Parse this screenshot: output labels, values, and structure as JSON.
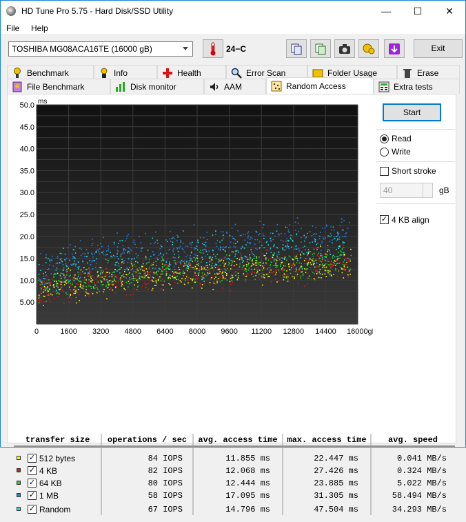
{
  "window": {
    "title": "HD Tune Pro 5.75 - Hard Disk/SSD Utility",
    "minimize": "—",
    "maximize": "☐",
    "close": "✕"
  },
  "menu": {
    "file": "File",
    "help": "Help"
  },
  "toolbar": {
    "drive": "TOSHIBA MG08ACA16TE (16000 gB)",
    "temperature": "24−C",
    "exit": "Exit"
  },
  "tabs": {
    "row1": [
      {
        "label": "Benchmark",
        "icon": "benchmark-icon"
      },
      {
        "label": "Info",
        "icon": "info-icon"
      },
      {
        "label": "Health",
        "icon": "health-icon"
      },
      {
        "label": "Error Scan",
        "icon": "error-scan-icon"
      },
      {
        "label": "Folder Usage",
        "icon": "folder-usage-icon"
      },
      {
        "label": "Erase",
        "icon": "erase-icon"
      }
    ],
    "row2": [
      {
        "label": "File Benchmark",
        "icon": "file-benchmark-icon"
      },
      {
        "label": "Disk monitor",
        "icon": "disk-monitor-icon"
      },
      {
        "label": "AAM",
        "icon": "aam-icon"
      },
      {
        "label": "Random Access",
        "icon": "random-access-icon",
        "active": true
      },
      {
        "label": "Extra tests",
        "icon": "extra-tests-icon"
      }
    ]
  },
  "controls": {
    "start": "Start",
    "read": "Read",
    "write": "Write",
    "read_selected": true,
    "short_stroke": "Short stroke",
    "short_stroke_checked": false,
    "short_stroke_value": "40",
    "short_stroke_unit": "gB",
    "align": "4 KB align",
    "align_checked": true
  },
  "chart_data": {
    "type": "scatter",
    "ylabel": "ms",
    "xunit": "gB",
    "ylim": [
      0,
      50
    ],
    "xlim": [
      0,
      16000
    ],
    "yticks": [
      "5.00",
      "10.0",
      "15.0",
      "20.0",
      "25.0",
      "30.0",
      "35.0",
      "40.0",
      "45.0",
      "50.0"
    ],
    "xticks": [
      "0",
      "1600",
      "3200",
      "4800",
      "6400",
      "8000",
      "9600",
      "11200",
      "12800",
      "14400",
      "16000gB"
    ],
    "grid": true,
    "background": "#1a1a1a",
    "series": [
      {
        "name": "512 bytes",
        "color": "#f5f518",
        "base": 6.5,
        "slope": 7.5,
        "spread": 3.5
      },
      {
        "name": "4 KB",
        "color": "#d41c1c",
        "base": 6.5,
        "slope": 7.5,
        "spread": 3.5
      },
      {
        "name": "64 KB",
        "color": "#1fd41f",
        "base": 7.5,
        "slope": 7.0,
        "spread": 3.5
      },
      {
        "name": "1 MB",
        "color": "#2a7fe0",
        "base": 12.0,
        "slope": 8.5,
        "spread": 4.0
      },
      {
        "name": "Random",
        "color": "#27d7e0",
        "base": 9.5,
        "slope": 8.0,
        "spread": 5.0
      }
    ]
  },
  "results": {
    "headers": [
      "transfer size",
      "operations / sec",
      "avg. access time",
      "max. access time",
      "avg. speed"
    ],
    "rows": [
      {
        "label": "512 bytes",
        "color": "#f5f518",
        "checked": true,
        "ops": "84 IOPS",
        "avg": "11.855 ms",
        "max": "22.447 ms",
        "speed": "0.041 MB/s"
      },
      {
        "label": "4 KB",
        "color": "#d41c1c",
        "checked": true,
        "ops": "82 IOPS",
        "avg": "12.068 ms",
        "max": "27.426 ms",
        "speed": "0.324 MB/s"
      },
      {
        "label": "64 KB",
        "color": "#1fd41f",
        "checked": true,
        "ops": "80 IOPS",
        "avg": "12.444 ms",
        "max": "23.885 ms",
        "speed": "5.022 MB/s"
      },
      {
        "label": "1 MB",
        "color": "#2a7fe0",
        "checked": true,
        "ops": "58 IOPS",
        "avg": "17.095 ms",
        "max": "31.305 ms",
        "speed": "58.494 MB/s"
      },
      {
        "label": "Random",
        "color": "#27d7e0",
        "checked": true,
        "ops": "67 IOPS",
        "avg": "14.796 ms",
        "max": "47.504 ms",
        "speed": "34.293 MB/s"
      }
    ]
  }
}
